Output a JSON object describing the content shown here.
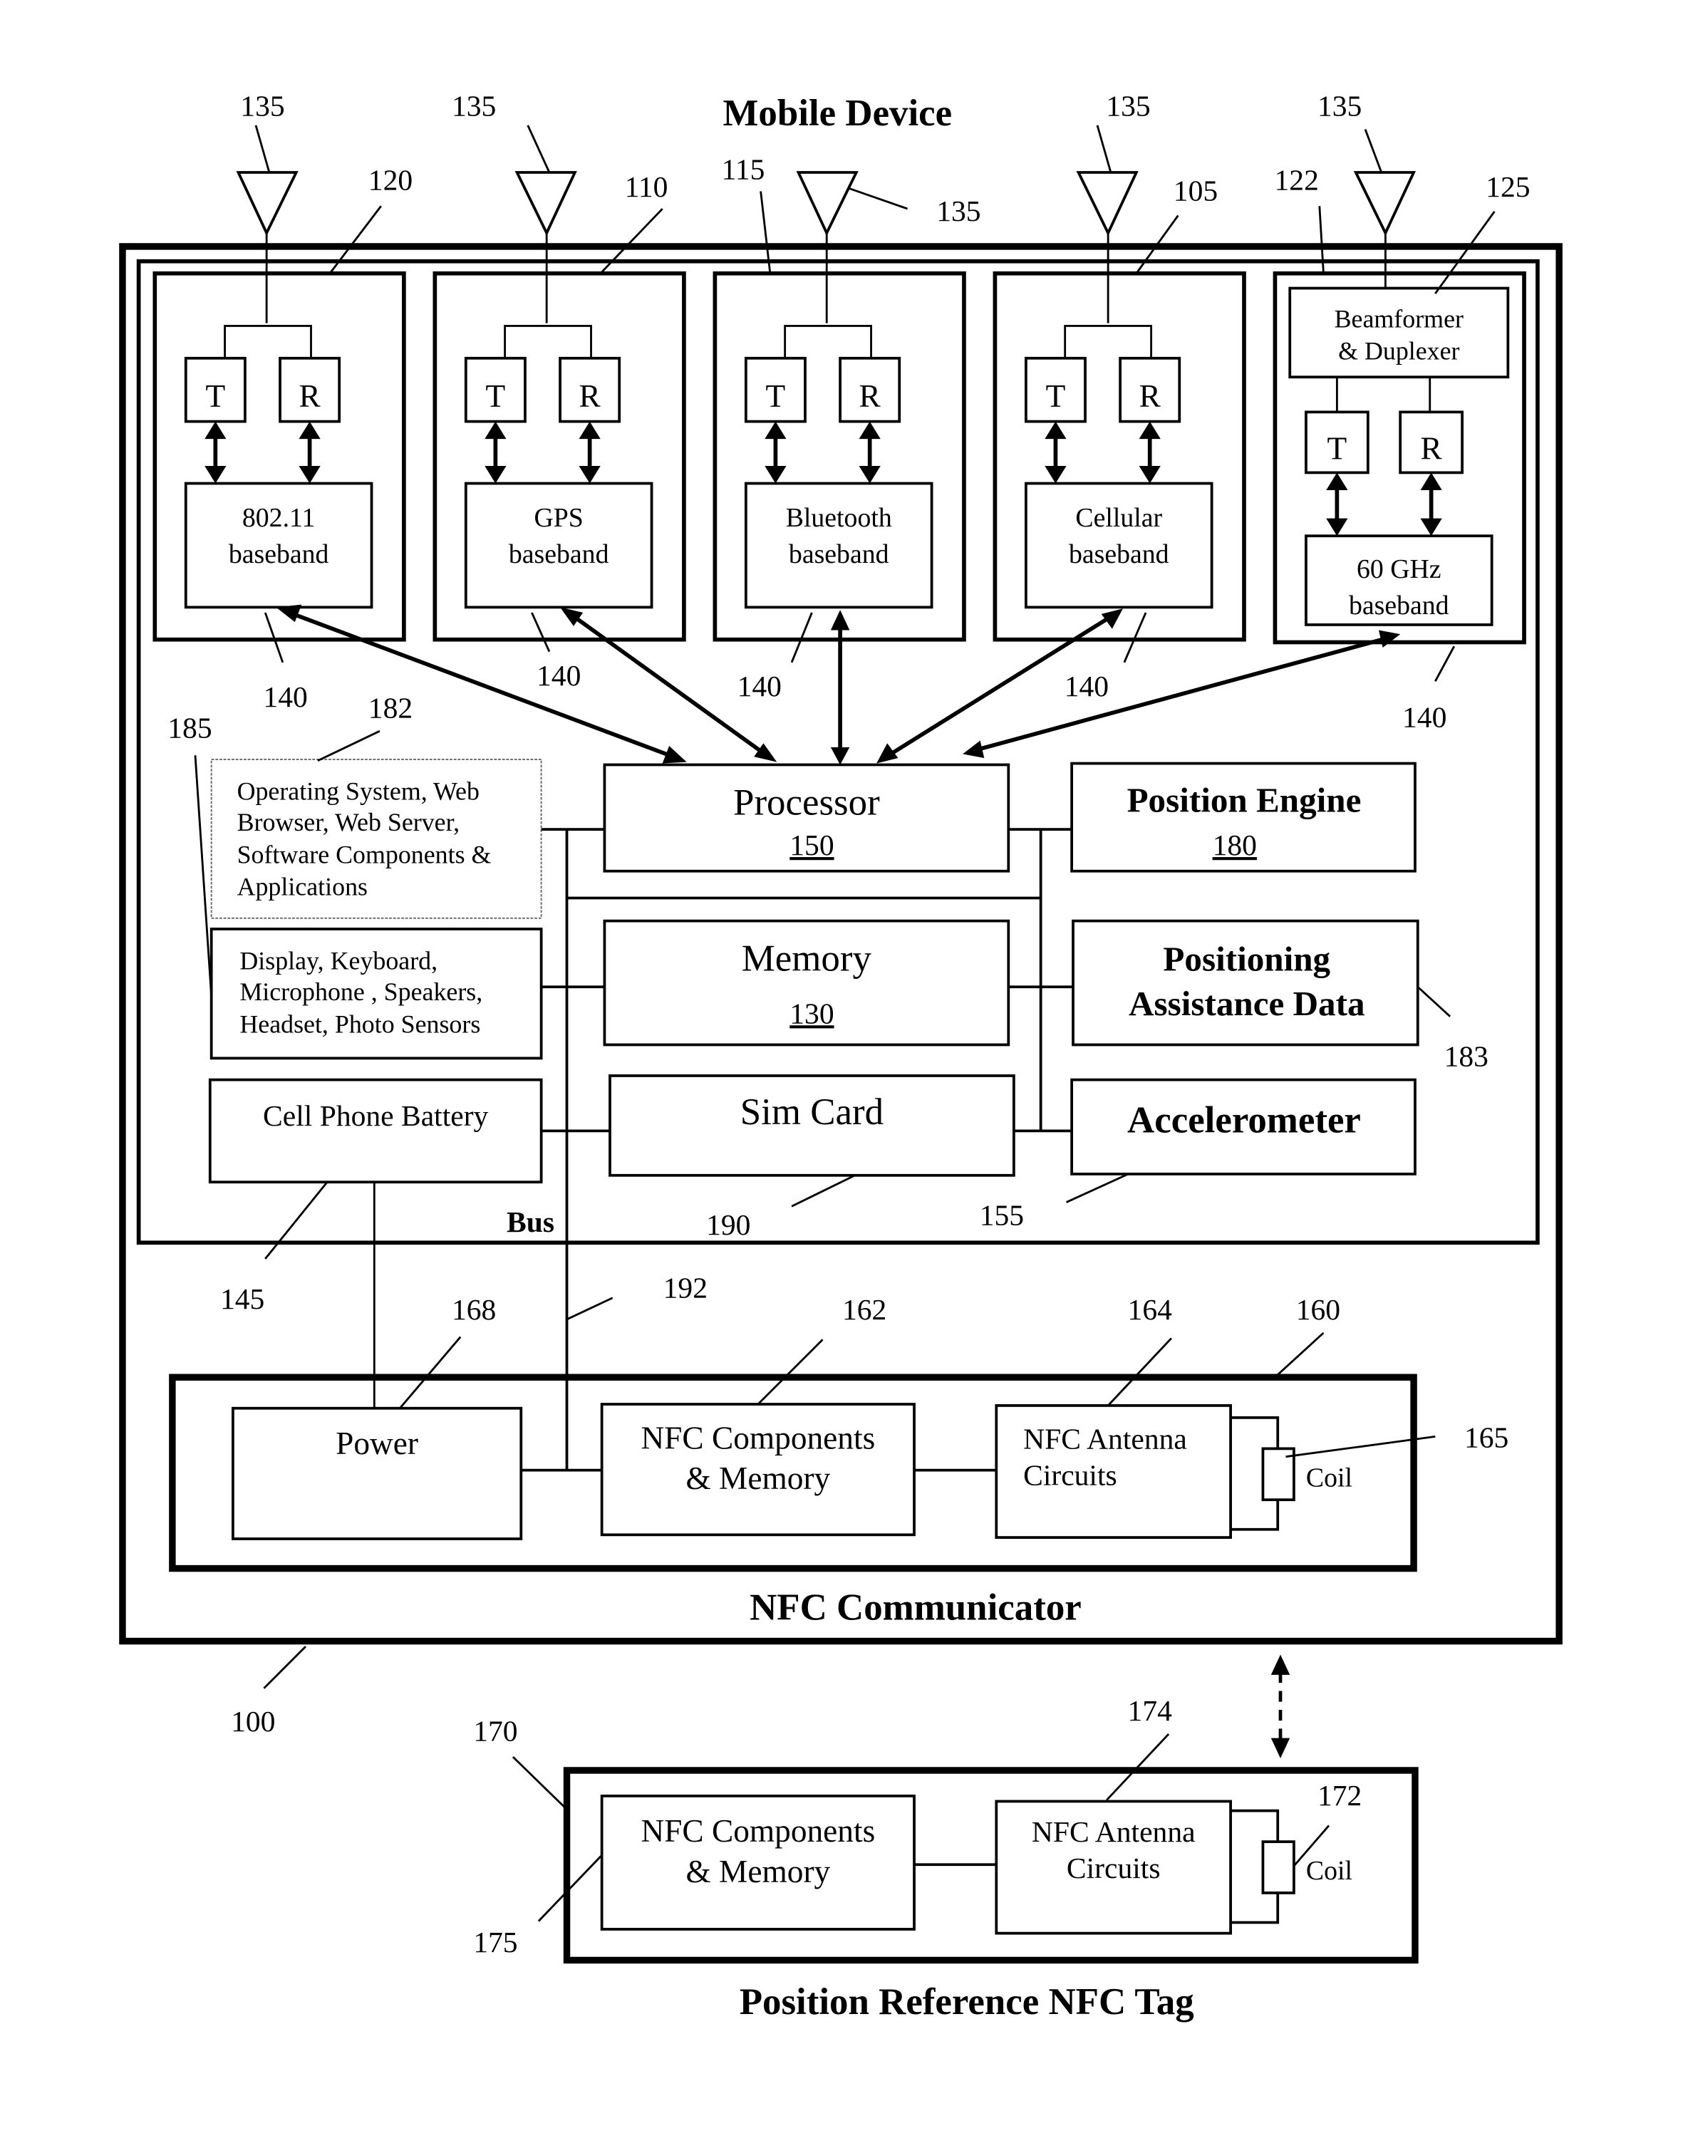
{
  "titles": {
    "mobile_device": "Mobile Device",
    "nfc_communicator": "NFC Communicator",
    "position_reference_tag": "Position Reference NFC Tag",
    "bus": "Bus"
  },
  "antenna_ref": "135",
  "radios": [
    {
      "ref": "120",
      "tx": "T",
      "rx": "R",
      "baseband_line1": "802.11",
      "baseband_line2": "baseband",
      "link_ref": "140"
    },
    {
      "ref": "110",
      "tx": "T",
      "rx": "R",
      "baseband_line1": "GPS",
      "baseband_line2": "baseband",
      "link_ref": "140"
    },
    {
      "ref": "115",
      "tx": "T",
      "rx": "R",
      "baseband_line1": "Bluetooth",
      "baseband_line2": "baseband",
      "link_ref": "140"
    },
    {
      "ref": "105",
      "tx": "T",
      "rx": "R",
      "baseband_line1": "Cellular",
      "baseband_line2": "baseband",
      "link_ref": "140"
    },
    {
      "ref": "122",
      "tx": "T",
      "rx": "R",
      "baseband_line1": "60 GHz",
      "baseband_line2": "baseband",
      "link_ref": "140",
      "beamformer_line1": "Beamformer",
      "beamformer_line2": "& Duplexer",
      "beamformer_ref": "125"
    }
  ],
  "components": {
    "software": {
      "ref": "182",
      "lines": [
        "Operating System, Web",
        "Browser, Web Server,",
        "Software Components &",
        "Applications"
      ]
    },
    "io": {
      "ref": "185",
      "lines": [
        "Display, Keyboard,",
        "Microphone , Speakers,",
        "Headset, Photo Sensors"
      ]
    },
    "battery": {
      "ref": "145",
      "label": "Cell Phone Battery"
    },
    "processor": {
      "label": "Processor",
      "ref": "150"
    },
    "memory": {
      "label": "Memory",
      "ref": "130"
    },
    "sim": {
      "label": "Sim Card",
      "ref": "190"
    },
    "position_engine": {
      "label": "Position Engine",
      "ref": "180"
    },
    "assistance": {
      "line1": "Positioning",
      "line2": "Assistance Data",
      "ref": "183"
    },
    "accelerometer": {
      "label": "Accelerometer",
      "ref": "155"
    },
    "bus_ref": "192",
    "device_ref": "100"
  },
  "nfc_communicator": {
    "ref": "160",
    "power": {
      "label": "Power",
      "ref": "168"
    },
    "components": {
      "line1": "NFC Components",
      "line2": "& Memory",
      "ref": "162"
    },
    "antenna": {
      "line1": "NFC Antenna",
      "line2": "Circuits",
      "ref": "164"
    },
    "coil": {
      "label": "Coil",
      "ref": "165"
    }
  },
  "nfc_tag": {
    "ref": "170",
    "components": {
      "line1": "NFC Components",
      "line2": "& Memory",
      "ref": "175"
    },
    "antenna": {
      "line1": "NFC Antenna",
      "line2": "Circuits",
      "ref": "174"
    },
    "coil": {
      "label": "Coil",
      "ref": "172"
    }
  }
}
